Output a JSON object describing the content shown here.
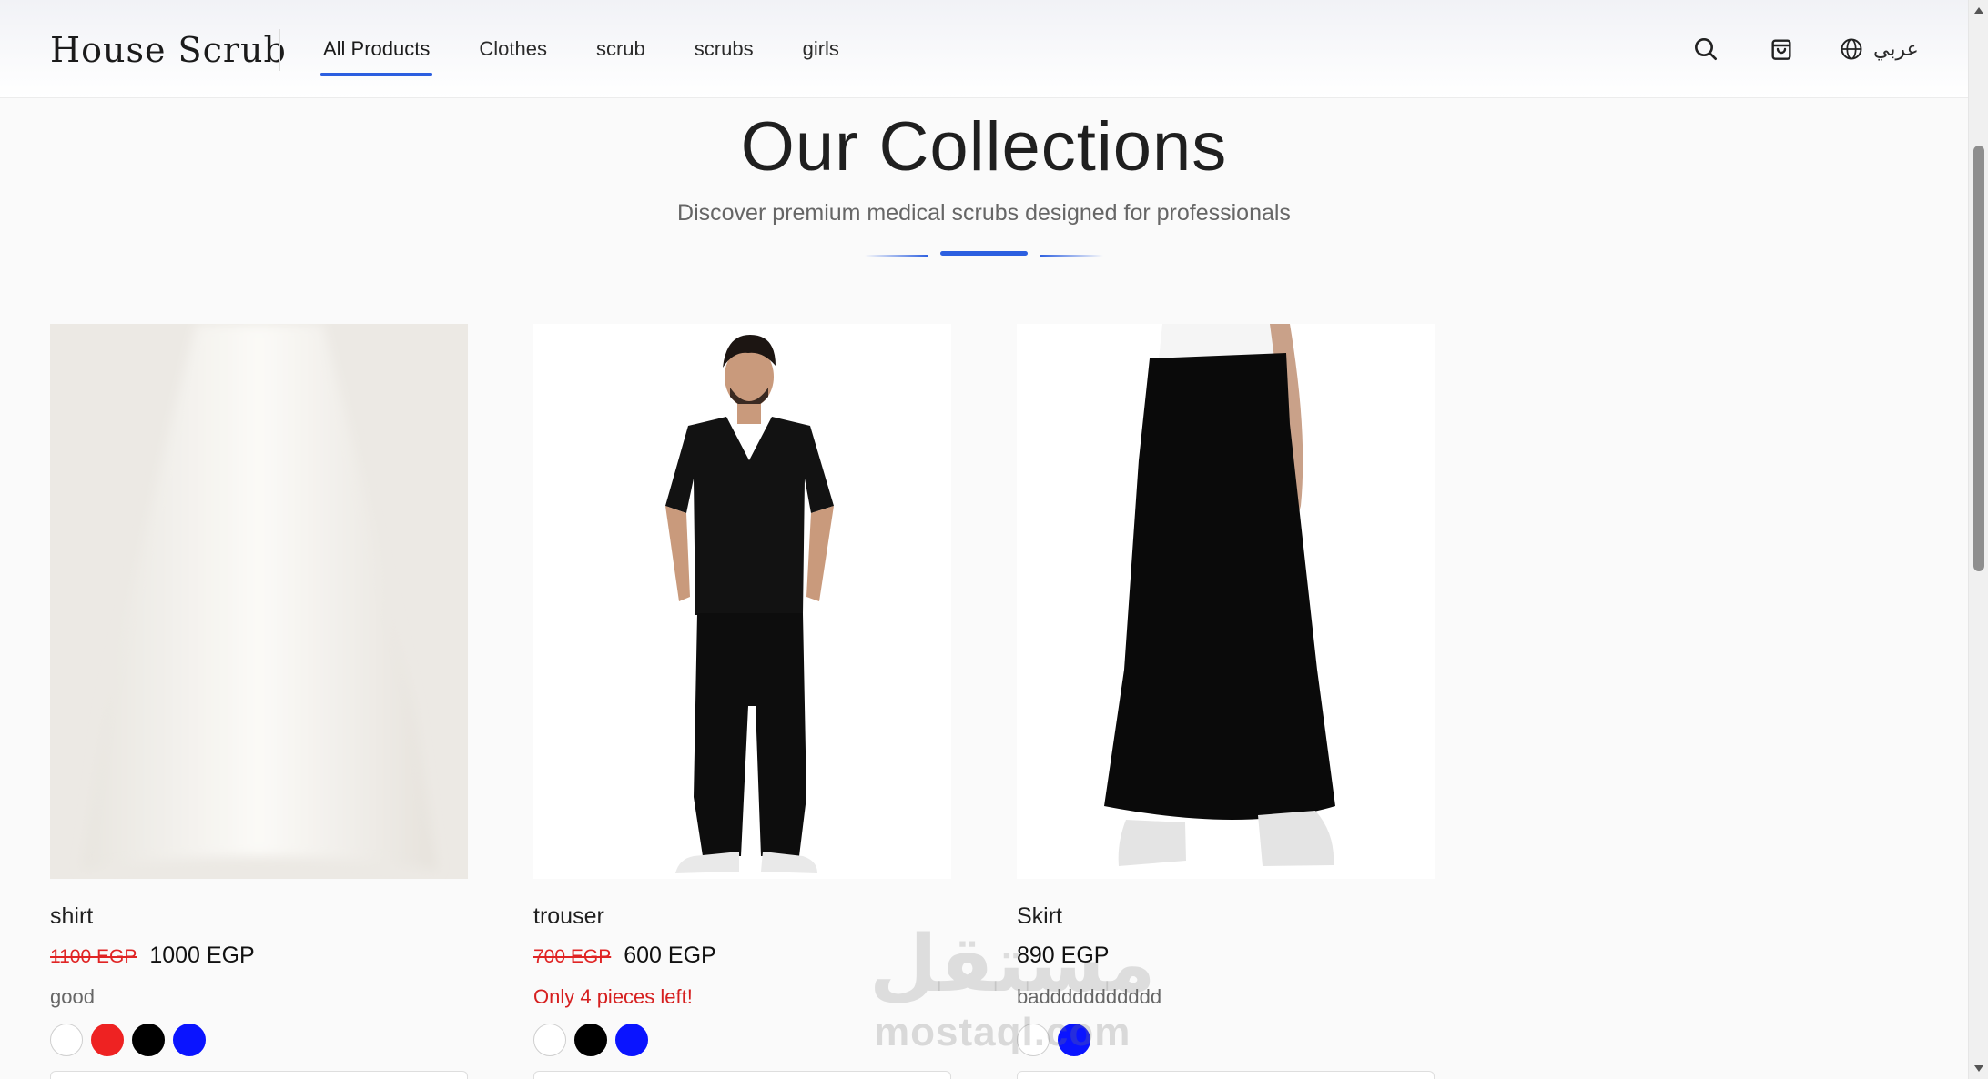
{
  "header": {
    "logo": "House Scrub",
    "nav": [
      {
        "label": "All Products",
        "active": true
      },
      {
        "label": "Clothes",
        "active": false
      },
      {
        "label": "scrub",
        "active": false
      },
      {
        "label": "scrubs",
        "active": false
      },
      {
        "label": "girls",
        "active": false
      }
    ],
    "icons": [
      "search-icon",
      "cart-icon",
      "globe-icon"
    ],
    "language_label": "عربي"
  },
  "hero": {
    "title": "Our Collections",
    "subtitle": "Discover premium medical scrubs designed for professionals"
  },
  "products": [
    {
      "name": "shirt",
      "old_price": "1100 EGP",
      "price": "1000 EGP",
      "note": "good",
      "note_alert": false,
      "colors": [
        "#ffffff",
        "#ee2222",
        "#000000",
        "#0a14ff"
      ]
    },
    {
      "name": "trouser",
      "old_price": "700 EGP",
      "price": "600 EGP",
      "note": "Only 4 pieces left!",
      "note_alert": true,
      "colors": [
        "#ffffff",
        "#000000",
        "#0a14ff"
      ]
    },
    {
      "name": "Skirt",
      "old_price": "",
      "price": "890 EGP",
      "note": "baddddddddddd",
      "note_alert": false,
      "colors": [
        "#ffffff",
        "#0a14ff"
      ]
    }
  ],
  "watermark": {
    "arabic": "مستقل",
    "latin": "mostaql.com"
  },
  "colors": {
    "accent": "#2c5fe0",
    "sale": "#e02424"
  }
}
